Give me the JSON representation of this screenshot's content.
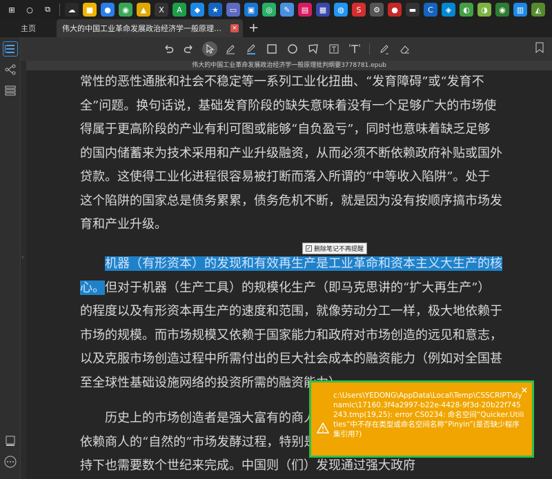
{
  "taskbar": {
    "icons": [
      {
        "name": "windows-start-icon",
        "glyph": "⊞",
        "color": "#1f1f1f"
      },
      {
        "name": "search-icon",
        "glyph": "○",
        "color": "#1f1f1f"
      },
      {
        "name": "task-view-icon",
        "glyph": "⧉",
        "color": "#1f1f1f"
      },
      {
        "name": "app-icon-1",
        "glyph": "☁",
        "color": "#2a2a2a"
      },
      {
        "name": "app-icon-2",
        "glyph": "■",
        "color": "#f0b400"
      },
      {
        "name": "app-icon-3",
        "glyph": "●",
        "color": "#2b7de9"
      },
      {
        "name": "chrome-icon",
        "glyph": "◉",
        "color": "#3aa757"
      },
      {
        "name": "app-icon-4",
        "glyph": "▲",
        "color": "#e0a800"
      },
      {
        "name": "app-icon-5",
        "glyph": "X",
        "color": "#333"
      },
      {
        "name": "app-icon-6",
        "glyph": "A",
        "color": "#1e9e4a"
      },
      {
        "name": "app-icon-7",
        "glyph": "◆",
        "color": "#1e88e5"
      },
      {
        "name": "app-icon-8",
        "glyph": "★",
        "color": "#1565c0"
      },
      {
        "name": "app-icon-9",
        "glyph": "▭",
        "color": "#5c6bc0"
      },
      {
        "name": "app-icon-10",
        "glyph": "▣",
        "color": "#1976d2"
      },
      {
        "name": "wechat-icon",
        "glyph": "◎",
        "color": "#2aae67"
      },
      {
        "name": "app-icon-11",
        "glyph": "✎",
        "color": "#4a90e2"
      },
      {
        "name": "app-icon-12",
        "glyph": "▤",
        "color": "#d81b60"
      },
      {
        "name": "app-icon-13",
        "glyph": "▦",
        "color": "#3949ab"
      },
      {
        "name": "app-icon-14",
        "glyph": "◍",
        "color": "#2196f3"
      },
      {
        "name": "app-icon-15",
        "glyph": "S",
        "color": "#d32f2f"
      },
      {
        "name": "app-icon-16",
        "glyph": "⚙",
        "color": "#555"
      },
      {
        "name": "app-icon-17",
        "glyph": "●",
        "color": "#c62828"
      },
      {
        "name": "app-icon-18",
        "glyph": "▬",
        "color": "#333"
      },
      {
        "name": "app-icon-19",
        "glyph": "C",
        "color": "#1565c0"
      },
      {
        "name": "app-icon-20",
        "glyph": "◈",
        "color": "#0288d1"
      },
      {
        "name": "app-icon-21",
        "glyph": "◐",
        "color": "#43a047"
      },
      {
        "name": "app-icon-22",
        "glyph": "◑",
        "color": "#7cb342"
      },
      {
        "name": "app-icon-23",
        "glyph": "◉",
        "color": "#2e7d32"
      },
      {
        "name": "app-icon-24",
        "glyph": "▥",
        "color": "#1e88e5"
      },
      {
        "name": "app-icon-25",
        "glyph": "◭",
        "color": "#558b2f"
      }
    ]
  },
  "tabs": {
    "home_label": "主页",
    "active_title": "伟大的中国工业革命发展政治经济学一般原理批判纲要",
    "close_glyph": "×",
    "new_tab_glyph": "+"
  },
  "file_title": "伟大的中国工业革命发展政治经济学一般原理批判纲要3778781.epub",
  "content": {
    "p1": "常性的恶性通胀和社会不稳定等一系列工业化扭曲、“发育障碍”或“发育不全”问题。换句话说，基础发育阶段的缺失意味着没有一个足够广大的市场使得属于更高阶段的产业有利可图或能够“自负盈亏”，同时也意味着缺乏足够的国内储蓄来为技术采用和产业升级融资，从而必须不断依赖政府补贴或国外贷款。这使得工业化进程很容易被打断而落入所谓的“中等收入陷阱”。处于这个陷阱的国家总是债务累累，债务危机不断，就是因为没有按顺序搞市场发育和产业升级。",
    "p2_highlight": "机器（有形资本）的发现和有效再生产是工业革命和资本主义大生产的核心。",
    "p2_rest": "但对于机器（生产工具）的规模化生产（即马克思讲的“扩大再生产”）的程度以及有形资本再生产的速度和范围，就像劳动分工一样，极大地依赖于市场的规模。而市场规模又依赖于国家能力和政府对市场创造的远见和意志，以及克服市场创造过程中所需付出的巨大社会成本的融资能力（例如对全国甚至全球性基础设施网络的投资所需的融资能力）。",
    "p3": "历史上的市场创造者是强大富有的商人，并且这个创造市场的过程是一种依赖商人的“自然的”市场发酵过程，特别是在缺乏国家能力和强力的政府支持下也需要数个世纪来完成。中国则（们）发现通过强大政府"
  },
  "note_hint": {
    "label": "删除笔记不再提醒",
    "check_glyph": "✓"
  },
  "toast": {
    "message": "c:\\Users\\YEDONG\\AppData\\Local\\Temp\\CSSCRIPT\\dynamic\\17160.3f4a2997-b22e-4428-9f3d-20b22f745243.tmp(19,25): error CS0234: 命名空间“Quicker.Utilities”中不存在类型或命名空间名称“Pinyin”(是否缺少程序集引用?)",
    "close_glyph": "×",
    "warning_glyph": "⚠"
  },
  "colors": {
    "highlight": "#1f82c8",
    "toast_bg": "#f0a500",
    "toast_border": "#2fbf4a",
    "accent": "#3e8ed0"
  }
}
